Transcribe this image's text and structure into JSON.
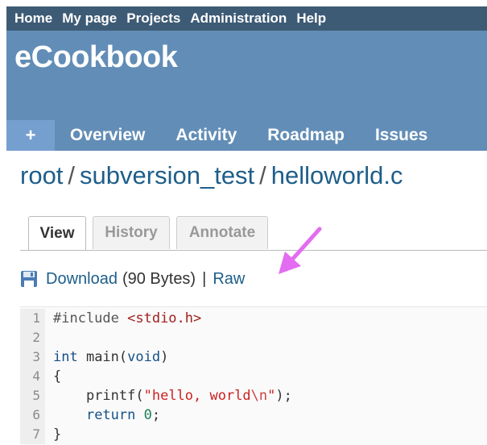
{
  "top_menu": {
    "items": [
      "Home",
      "My page",
      "Projects",
      "Administration",
      "Help"
    ]
  },
  "header": {
    "title": "eCookbook"
  },
  "main_menu": {
    "plus": "+",
    "items": [
      "Overview",
      "Activity",
      "Roadmap",
      "Issues"
    ]
  },
  "breadcrumb": {
    "parts": [
      "root",
      "subversion_test",
      "helloworld.c"
    ],
    "separator": "/"
  },
  "tabs": {
    "view": "View",
    "history": "History",
    "annotate": "Annotate",
    "selected": "View"
  },
  "download": {
    "link": "Download",
    "size": "(90 Bytes)",
    "separator": "|",
    "raw": "Raw"
  },
  "code": {
    "line_numbers": [
      "1",
      "2",
      "3",
      "4",
      "5",
      "6",
      "7"
    ],
    "lines": [
      {
        "directive": "#include ",
        "header": "<stdio.h>"
      },
      {},
      {
        "type": "int",
        "name": " main(",
        "param": "void",
        "close": ")"
      },
      {
        "brace": "{"
      },
      {
        "indent": "    ",
        "call": "printf(",
        "str_open": "\"hello, world",
        "escape": "\\n",
        "str_close": "\"",
        "end": ");"
      },
      {
        "indent": "    ",
        "keyword": "return",
        "space": " ",
        "number": "0",
        "end": ";"
      },
      {
        "brace": "}"
      }
    ]
  },
  "colors": {
    "top_menu_bg": "#3e5b76",
    "header_bg": "#628db6",
    "link": "#1e5e8a",
    "arrow": "#e36cf0"
  },
  "icons": [
    "disk-icon",
    "arrow-annotation"
  ]
}
